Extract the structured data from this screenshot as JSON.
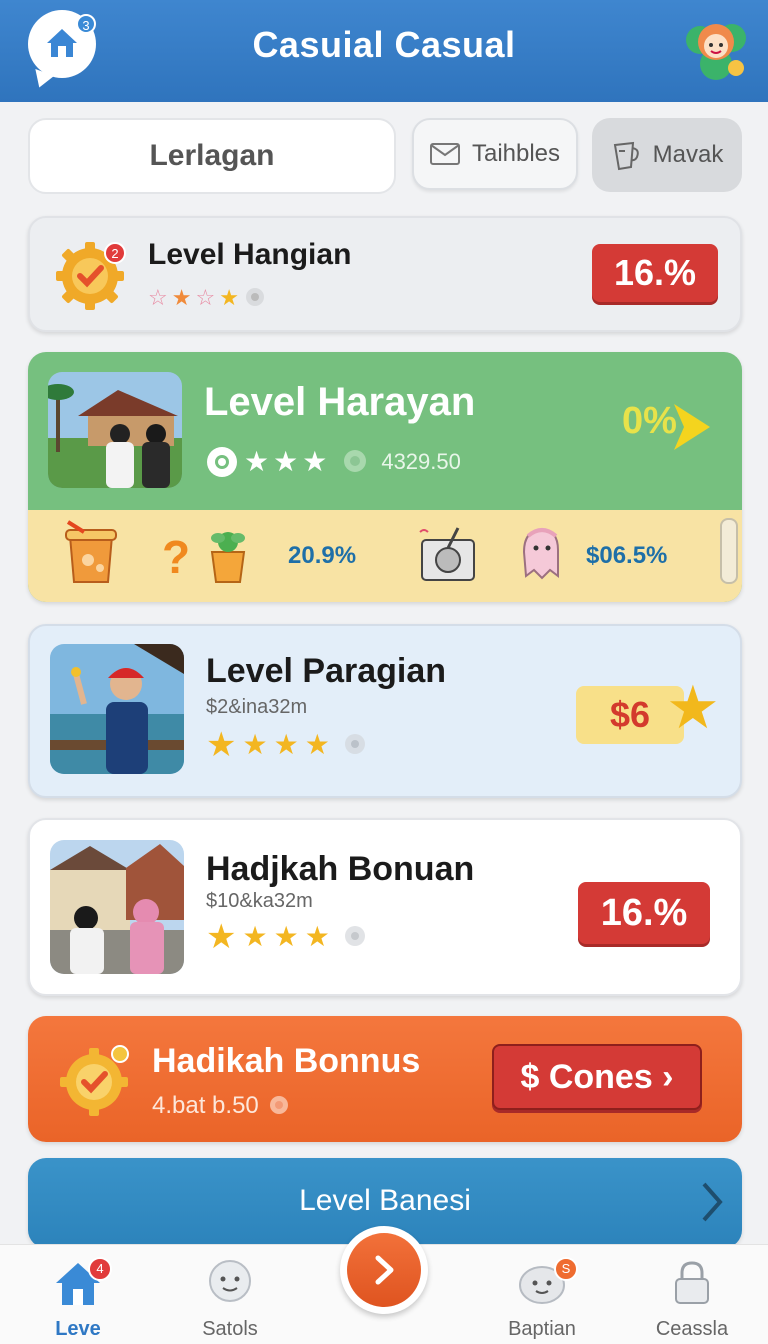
{
  "header": {
    "title": "Casuial Casual",
    "home_count": "3"
  },
  "tabs": [
    {
      "label": "Lerlagan"
    },
    {
      "label": "Taihbles",
      "icon": "mail-icon"
    },
    {
      "label": "Mavak",
      "icon": "cup-icon"
    }
  ],
  "cards": {
    "card1": {
      "title": "Level Hangian",
      "badge": "2",
      "percent": "16.%",
      "stars_filled": 2,
      "stars_total": 4
    },
    "card2": {
      "title": "Level Harayan",
      "score": "4329.50",
      "percent": "0%",
      "stars_filled": 3,
      "strip": {
        "value_1": "20.9%",
        "question": "?",
        "value_2": "$06.5%"
      }
    },
    "card3": {
      "title": "Level Paragian",
      "subtitle": "$2&ina32m",
      "price": "$6",
      "stars_filled": 4
    },
    "card4": {
      "title": "Hadjkah Bonuan",
      "subtitle": "$10&ka32m",
      "percent": "16.%",
      "stars_filled": 4
    },
    "card5": {
      "title": "Hadikah Bonnus",
      "subtitle": "4.bat b.50",
      "button_label": "$ Cones ›"
    },
    "card6": {
      "label": "Level Banesi"
    }
  },
  "bottom_nav": [
    {
      "label": "Leve",
      "badge": "4",
      "active": true
    },
    {
      "label": "Satols"
    },
    {
      "label": "Baptian",
      "badge": "S"
    },
    {
      "label": "Ceassla"
    }
  ],
  "colors": {
    "header_blue": "#3a7fc8",
    "accent_green": "#76c07f",
    "accent_orange": "#ef6c30",
    "badge_red": "#d43a36",
    "link_blue": "#2f78c4"
  }
}
